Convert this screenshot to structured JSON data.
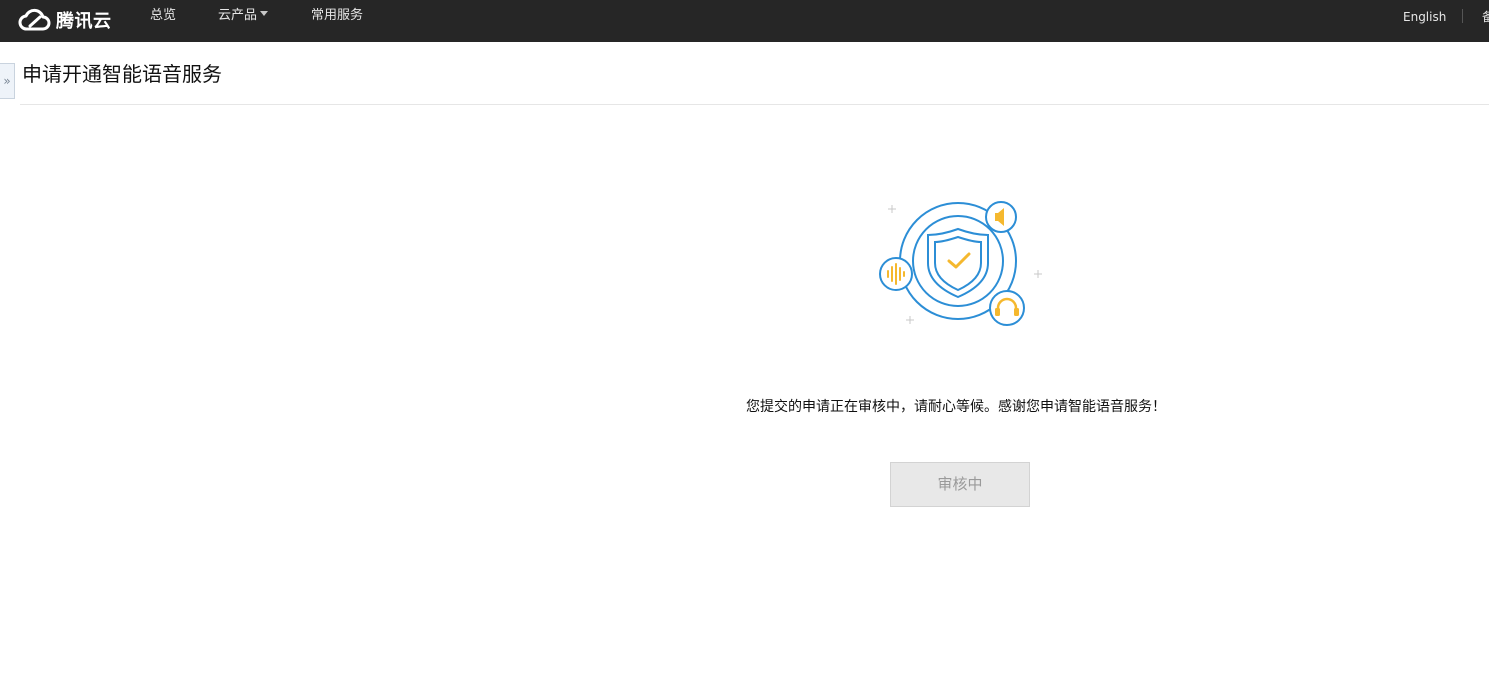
{
  "topbar": {
    "logo_text": "腾讯云",
    "nav": [
      {
        "label": "总览"
      },
      {
        "label": "云产品",
        "has_dropdown": true
      },
      {
        "label": "常用服务"
      }
    ],
    "language": "English",
    "cut_label": "备"
  },
  "sidebar": {
    "toggle_glyph": "»"
  },
  "page": {
    "title": "申请开通智能语音服务",
    "message": "您提交的申请正在审核中，请耐心等候。感谢您申请智能语音服务！",
    "status_button": "审核中"
  },
  "colors": {
    "topbar_bg": "#262626",
    "accent_blue": "#2c8ed6",
    "accent_yellow": "#f5b82e",
    "disabled_bg": "#e8e8e8",
    "disabled_text": "#9a9a9a"
  },
  "icons": {
    "logo": "cloud-logo-icon",
    "illustration": "shield-check-icon",
    "speaker": "speaker-icon",
    "waveform": "waveform-icon",
    "headphones": "headphones-icon"
  }
}
